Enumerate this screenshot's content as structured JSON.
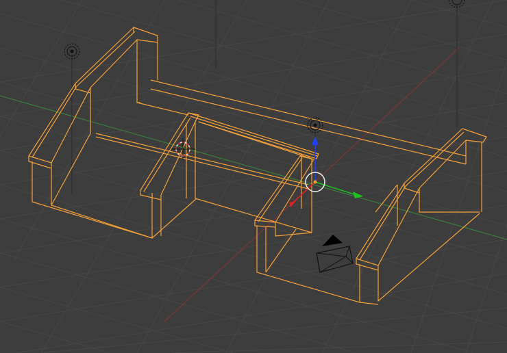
{
  "viewport": {
    "background": "#3d3d3d",
    "grid_color": "#484848",
    "x_axis_color": "#a03a3a",
    "y_axis_color": "#3f8f3f",
    "selection_color": "#f5a13a",
    "camera_color": "#000000"
  },
  "objects": [
    {
      "name": "left-stair",
      "type": "mesh",
      "selected": true
    },
    {
      "name": "center-stair-bridge",
      "type": "mesh",
      "selected": true
    },
    {
      "name": "right-stair",
      "type": "mesh",
      "selected": true
    },
    {
      "name": "back-wall-frame",
      "type": "mesh",
      "selected": true
    }
  ],
  "lamps": [
    {
      "name": "lamp-left"
    },
    {
      "name": "lamp-center"
    },
    {
      "name": "lamp-top-right"
    }
  ],
  "gizmo": {
    "mode": "translate",
    "x_color": "#e02020",
    "y_color": "#20c020",
    "z_color": "#2040ff"
  },
  "camera": {
    "name": "camera"
  },
  "cursor_3d": {
    "name": "3d-cursor"
  }
}
